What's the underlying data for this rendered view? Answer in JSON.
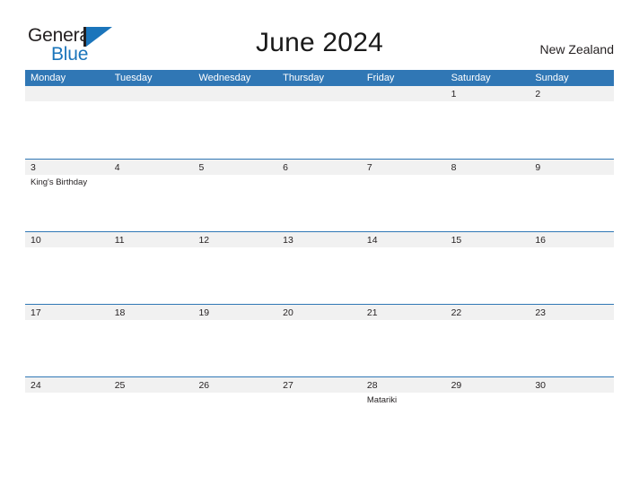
{
  "brand": {
    "name_part1": "General",
    "name_part2": "Blue",
    "logo_icon": "general-blue-flag-icon"
  },
  "header": {
    "title": "June 2024",
    "country": "New Zealand"
  },
  "colors": {
    "header_blue": "#3077B5",
    "band_gray": "#F1F1F1",
    "brand_blue": "#1B75BB",
    "text": "#231F20",
    "page_background": "#FFFFFF"
  },
  "calendar": {
    "weekday_headers": [
      "Monday",
      "Tuesday",
      "Wednesday",
      "Thursday",
      "Friday",
      "Saturday",
      "Sunday"
    ],
    "weeks": [
      [
        {
          "day": "",
          "events": []
        },
        {
          "day": "",
          "events": []
        },
        {
          "day": "",
          "events": []
        },
        {
          "day": "",
          "events": []
        },
        {
          "day": "",
          "events": []
        },
        {
          "day": "1",
          "events": []
        },
        {
          "day": "2",
          "events": []
        }
      ],
      [
        {
          "day": "3",
          "events": [
            "King's Birthday"
          ]
        },
        {
          "day": "4",
          "events": []
        },
        {
          "day": "5",
          "events": []
        },
        {
          "day": "6",
          "events": []
        },
        {
          "day": "7",
          "events": []
        },
        {
          "day": "8",
          "events": []
        },
        {
          "day": "9",
          "events": []
        }
      ],
      [
        {
          "day": "10",
          "events": []
        },
        {
          "day": "11",
          "events": []
        },
        {
          "day": "12",
          "events": []
        },
        {
          "day": "13",
          "events": []
        },
        {
          "day": "14",
          "events": []
        },
        {
          "day": "15",
          "events": []
        },
        {
          "day": "16",
          "events": []
        }
      ],
      [
        {
          "day": "17",
          "events": []
        },
        {
          "day": "18",
          "events": []
        },
        {
          "day": "19",
          "events": []
        },
        {
          "day": "20",
          "events": []
        },
        {
          "day": "21",
          "events": []
        },
        {
          "day": "22",
          "events": []
        },
        {
          "day": "23",
          "events": []
        }
      ],
      [
        {
          "day": "24",
          "events": []
        },
        {
          "day": "25",
          "events": []
        },
        {
          "day": "26",
          "events": []
        },
        {
          "day": "27",
          "events": []
        },
        {
          "day": "28",
          "events": [
            "Matariki"
          ]
        },
        {
          "day": "29",
          "events": []
        },
        {
          "day": "30",
          "events": []
        }
      ]
    ]
  }
}
